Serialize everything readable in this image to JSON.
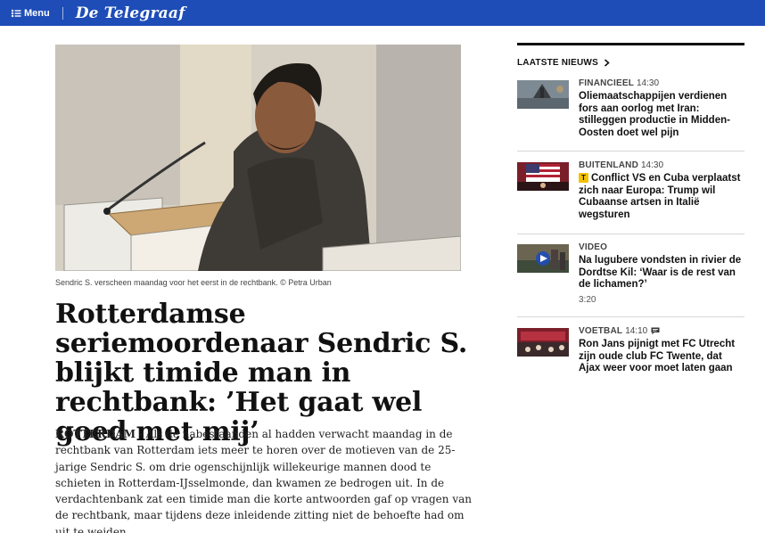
{
  "topbar": {
    "menu_label": "Menu",
    "logo_text": "De Telegraaf",
    "bg_color": "#1e4db7"
  },
  "article": {
    "image_caption": "Sendric S. verscheen maandag voor het eerst in de rechtbank. © Petra Urban",
    "headline": "Rotterdamse seriemoordenaar Sendric S. blijkt timide man in rechtbank: ’Het gaat wel goed met mij’",
    "dateline": "ROTTERDAM",
    "intro": " - Als de nabestaanden al hadden verwacht maandag in de rechtbank van Rotterdam iets meer te horen over de motieven van de 25-jarige Sendric S. om drie ogenschijnlijk willekeurige mannen dood te schieten in Rotterdam-IJsselmonde, dan kwamen ze bedrogen uit. In de verdachtenbank zat een timide man die korte antwoorden gaf op vragen van de rechtbank, maar tijdens deze inleidende zitting niet de behoefte had om uit te weiden."
  },
  "sidebar": {
    "header": "LAATSTE NIEUWS",
    "items": [
      {
        "category": "FINANCIEEL",
        "time": "14:30",
        "title": "Oliemaatschappijen verdienen fors aan oorlog met Iran: stilleggen productie in Midden-Oosten doet wel pijn",
        "thumb_icon": "oil-rig-image"
      },
      {
        "category": "BUITENLAND",
        "time": "14:30",
        "premium_badge": "T",
        "title": "Conflict VS en Cuba verplaatst zich naar Europa: Trump wil Cubaanse artsen in Italië wegsturen",
        "thumb_icon": "us-flag-image"
      },
      {
        "category": "VIDEO",
        "time": "",
        "title": "Na lugubere vondsten in rivier de Dordtse Kil: ‘Waar is de rest van de lichamen?’",
        "duration": "3:20",
        "thumb_icon": "video-play-icon"
      },
      {
        "category": "VOETBAL",
        "time": "14:10",
        "title": "Ron Jans pijnigt met FC Utrecht zijn oude club FC Twente, dat Ajax weer voor moet laten gaan",
        "thumb_icon": "football-banner-image"
      }
    ]
  }
}
